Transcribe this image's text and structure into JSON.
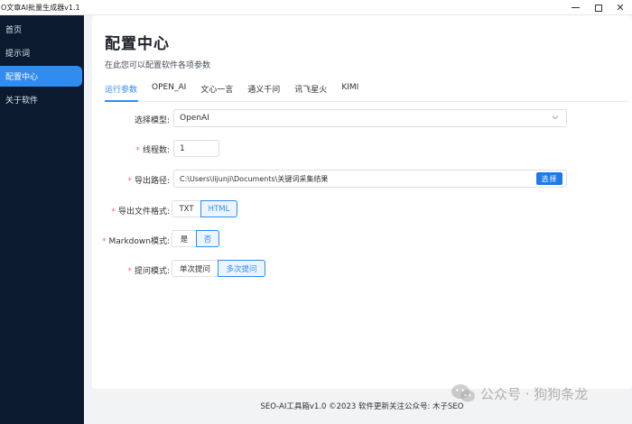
{
  "window": {
    "title": "O文章AI批量生成器v1.1",
    "minimize_icon": "minimize-icon",
    "maximize_icon": "maximize-icon",
    "close_icon": "close-icon",
    "close_glyph": "✕"
  },
  "sidebar": {
    "items": [
      {
        "label": "首页"
      },
      {
        "label": "提示词"
      },
      {
        "label": "配置中心",
        "active": true
      },
      {
        "label": "关于软件"
      }
    ]
  },
  "main": {
    "title": "配置中心",
    "subtitle": "在此您可以配置软件各项参数",
    "tabs": [
      {
        "label": "运行参数",
        "active": true
      },
      {
        "label": "OPEN_AI"
      },
      {
        "label": "文心一言"
      },
      {
        "label": "通义千问"
      },
      {
        "label": "讯飞星火"
      },
      {
        "label": "KIMI"
      }
    ]
  },
  "form": {
    "required_mark": "*",
    "model": {
      "label": "选择模型:",
      "value": "OpenAI",
      "icon": "chevron-down-icon"
    },
    "threads": {
      "label": "线程数:",
      "value": "1"
    },
    "export_path": {
      "label": "导出路径:",
      "value": "C:\\Users\\lijunji\\Documents\\关键词采集结果",
      "button": "选择"
    },
    "export_format": {
      "label": "导出文件格式:",
      "options": [
        "TXT",
        "HTML"
      ],
      "selected": "HTML"
    },
    "markdown": {
      "label": "Markdown模式:",
      "options": [
        "是",
        "否"
      ],
      "selected": "否"
    },
    "question_mode": {
      "label": "提问模式:",
      "options": [
        "单次提问",
        "多次提问"
      ],
      "selected": "多次提问"
    }
  },
  "footer": {
    "text": "SEO-AI工具箱v1.0 ©2023 软件更新关注公众号: 木子SEO"
  },
  "watermark": {
    "text": "公众号 · 狗狗条龙",
    "icon": "wechat-icon"
  },
  "colors": {
    "accent": "#2f8cf0",
    "sidebar_bg": "#0b1a2e",
    "required": "#f56c6c"
  }
}
